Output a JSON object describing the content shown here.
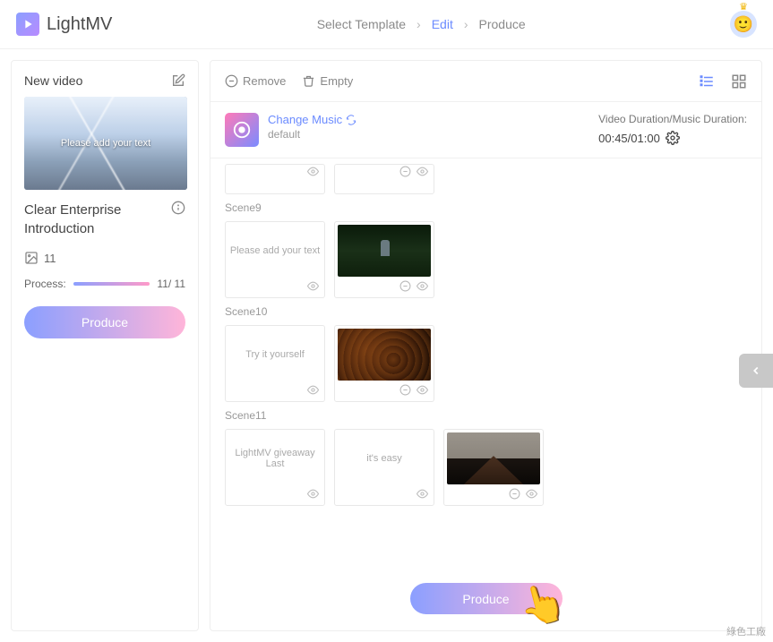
{
  "brand": "LightMV",
  "breadcrumbs": {
    "step1": "Select Template",
    "step2": "Edit",
    "step3": "Produce"
  },
  "sidebar": {
    "new_video": "New video",
    "preview_overlay": "Please add your text",
    "template_title": "Clear Enterprise Introduction",
    "image_count": "11",
    "process_label": "Process:",
    "process_value": "11/ 11",
    "produce_btn": "Produce"
  },
  "toolbar": {
    "remove": "Remove",
    "empty": "Empty"
  },
  "music": {
    "change": "Change Music",
    "default": "default",
    "duration_label": "Video Duration/Music Duration:",
    "duration_value": "00:45/01:00"
  },
  "scenes": [
    {
      "tag": "",
      "clips": [
        {
          "type": "short-empty"
        },
        {
          "type": "short-media"
        }
      ]
    },
    {
      "tag": "Scene9",
      "clips": [
        {
          "type": "text",
          "text": "Please add your text"
        },
        {
          "type": "media",
          "thumb": "forest"
        }
      ]
    },
    {
      "tag": "Scene10",
      "clips": [
        {
          "type": "text",
          "text": "Try it yourself"
        },
        {
          "type": "media",
          "thumb": "leaves"
        }
      ]
    },
    {
      "tag": "Scene11",
      "clips": [
        {
          "type": "text",
          "text": "LightMV giveaway Last"
        },
        {
          "type": "text",
          "text": "it's easy"
        },
        {
          "type": "media",
          "thumb": "mountain"
        }
      ]
    }
  ],
  "footer": {
    "produce_btn": "Produce"
  },
  "watermark": "綠色工廠"
}
